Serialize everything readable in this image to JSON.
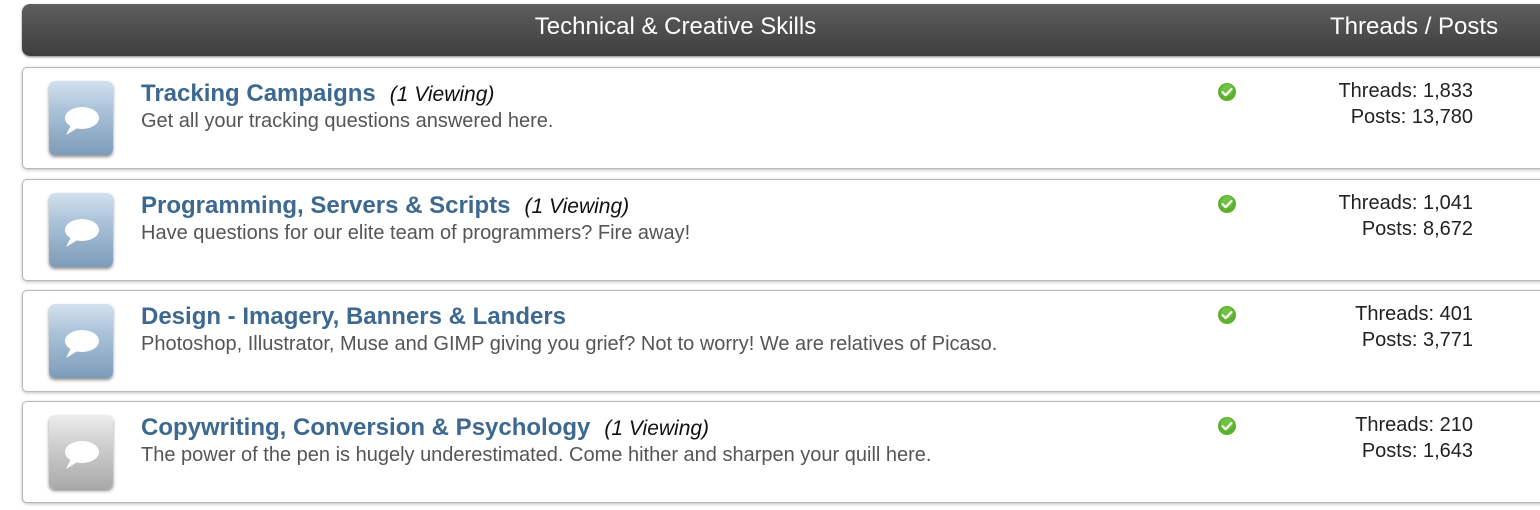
{
  "header": {
    "title": "Technical & Creative Skills",
    "stats_label": "Threads / Posts"
  },
  "forums": [
    {
      "title": "Tracking Campaigns",
      "viewing": "(1 Viewing)",
      "description": "Get all your tracking questions answered here.",
      "threads": "Threads: 1,833",
      "posts": "Posts: 13,780",
      "icon": "speech-bubble-icon",
      "icon_color": "blue"
    },
    {
      "title": "Programming, Servers & Scripts",
      "viewing": "(1 Viewing)",
      "description": "Have questions for our elite team of programmers? Fire away!",
      "threads": "Threads: 1,041",
      "posts": "Posts: 8,672",
      "icon": "speech-bubble-icon",
      "icon_color": "blue"
    },
    {
      "title": "Design - Imagery, Banners & Landers",
      "viewing": "",
      "description": "Photoshop, Illustrator, Muse and GIMP giving you grief? Not to worry! We are relatives of Picaso.",
      "threads": "Threads: 401",
      "posts": "Posts: 3,771",
      "icon": "speech-bubble-icon",
      "icon_color": "blue"
    },
    {
      "title": "Copywriting, Conversion & Psychology",
      "viewing": "(1 Viewing)",
      "description": "The power of the pen is hugely underestimated. Come hither and sharpen your quill here.",
      "threads": "Threads: 210",
      "posts": "Posts: 1,643",
      "icon": "speech-bubble-icon",
      "icon_color": "gray"
    }
  ],
  "colors": {
    "header_bg": "#4a4a4a",
    "title_link": "#3d6990",
    "status_green": "#5cb030"
  }
}
